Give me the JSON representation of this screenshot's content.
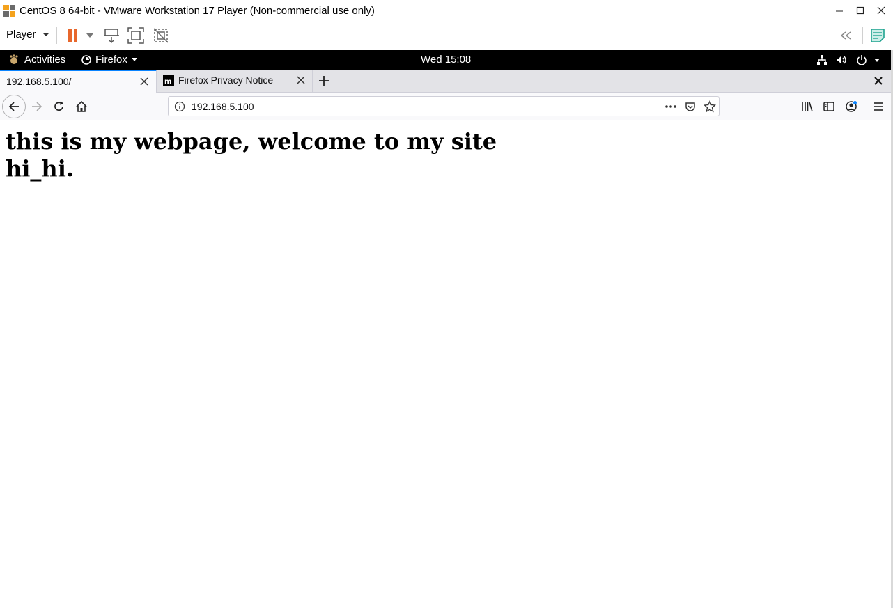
{
  "window": {
    "title": "CentOS 8 64-bit - VMware Workstation 17 Player (Non-commercial use only)"
  },
  "vm_toolbar": {
    "player_label": "Player",
    "pause_color": "#e8672c",
    "accent_note_color": "#1fa38f"
  },
  "gnome": {
    "activities_label": "Activities",
    "app_menu_label": "Firefox",
    "clock": "Wed 15:08"
  },
  "browser": {
    "tabs": [
      {
        "label": "192.168.5.100/",
        "active": true
      },
      {
        "label": "Firefox Privacy Notice — ",
        "active": false
      }
    ],
    "url": "192.168.5.100",
    "accent_color": "#0a84ff"
  },
  "page": {
    "heading_line1": "this is my webpage, welcome to my site",
    "heading_line2": "hi_hi."
  }
}
